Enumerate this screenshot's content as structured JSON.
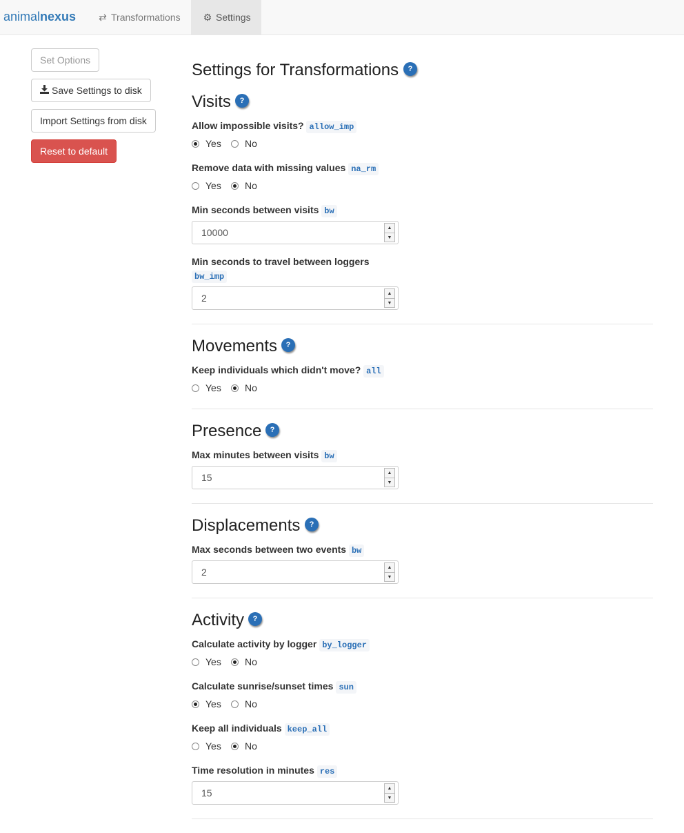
{
  "navbar": {
    "brand_light": "animal",
    "brand_bold": "nexus",
    "tabs": [
      {
        "label": "Transformations",
        "icon": "arrows-exchange-icon"
      },
      {
        "label": "Settings",
        "icon": "gear-icon",
        "active": true
      }
    ]
  },
  "sidebar": {
    "set_options": "Set Options",
    "save": "Save Settings to disk",
    "import": "Import Settings from disk",
    "reset": "Reset to default"
  },
  "main": {
    "title": "Settings for Transformations",
    "help": "?",
    "yes": "Yes",
    "no": "No",
    "visits": {
      "heading": "Visits",
      "allow_imp": {
        "label": "Allow impossible visits?",
        "code": "allow_imp",
        "value": "Yes"
      },
      "na_rm": {
        "label": "Remove data with missing values",
        "code": "na_rm",
        "value": "No"
      },
      "bw": {
        "label": "Min seconds between visits",
        "code": "bw",
        "value": "10000"
      },
      "bw_imp": {
        "label": "Min seconds to travel between loggers",
        "code": "bw_imp",
        "value": "2"
      }
    },
    "movements": {
      "heading": "Movements",
      "all": {
        "label": "Keep individuals which didn't move?",
        "code": "all",
        "value": "No"
      }
    },
    "presence": {
      "heading": "Presence",
      "bw": {
        "label": "Max minutes between visits",
        "code": "bw",
        "value": "15"
      }
    },
    "displacements": {
      "heading": "Displacements",
      "bw": {
        "label": "Max seconds between two events",
        "code": "bw",
        "value": "2"
      }
    },
    "activity": {
      "heading": "Activity",
      "by_logger": {
        "label": "Calculate activity by logger",
        "code": "by_logger",
        "value": "No"
      },
      "sun": {
        "label": "Calculate sunrise/sunset times",
        "code": "sun",
        "value": "Yes"
      },
      "keep_all": {
        "label": "Keep all individuals",
        "code": "keep_all",
        "value": "No"
      },
      "res": {
        "label": "Time resolution in minutes",
        "code": "res",
        "value": "15"
      }
    }
  }
}
